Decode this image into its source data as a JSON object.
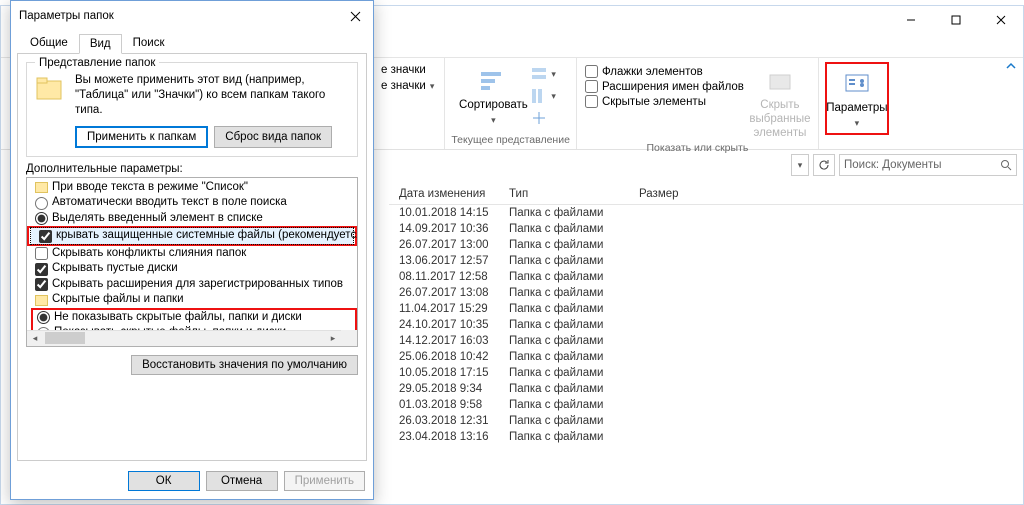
{
  "explorer": {
    "window_btns": {
      "help": "?"
    },
    "ribbon": {
      "groups": {
        "layout": {
          "small_icons": "е значки",
          "icons": "е значки",
          "group_label": ""
        },
        "view": {
          "sort": "Сортировать",
          "group_label": "Текущее представление"
        },
        "showhide": {
          "chk_flags": "Флажки элементов",
          "chk_ext": "Расширения имен файлов",
          "chk_hidden": "Скрытые элементы",
          "hide_selected": "Скрыть выбранные\nэлементы",
          "group_label": "Показать или скрыть"
        },
        "options": {
          "label": "Параметры"
        }
      }
    },
    "search": {
      "placeholder": "Поиск: Документы"
    },
    "grid": {
      "headers": {
        "date": "Дата изменения",
        "type": "Тип",
        "size": "Размер"
      },
      "rows": [
        {
          "date": "10.01.2018 14:15",
          "type": "Папка с файлами"
        },
        {
          "date": "14.09.2017 10:36",
          "type": "Папка с файлами"
        },
        {
          "date": "26.07.2017 13:00",
          "type": "Папка с файлами"
        },
        {
          "date": "13.06.2017 12:57",
          "type": "Папка с файлами"
        },
        {
          "date": "08.11.2017 12:58",
          "type": "Папка с файлами"
        },
        {
          "date": "26.07.2017 13:08",
          "type": "Папка с файлами"
        },
        {
          "date": "11.04.2017 15:29",
          "type": "Папка с файлами"
        },
        {
          "date": "24.10.2017 10:35",
          "type": "Папка с файлами"
        },
        {
          "date": "14.12.2017 16:03",
          "type": "Папка с файлами"
        },
        {
          "date": "25.06.2018 10:42",
          "type": "Папка с файлами"
        },
        {
          "date": "10.05.2018 17:15",
          "type": "Папка с файлами"
        },
        {
          "date": "29.05.2018 9:34",
          "type": "Папка с файлами"
        },
        {
          "date": "01.03.2018 9:58",
          "type": "Папка с файлами"
        },
        {
          "date": "26.03.2018 12:31",
          "type": "Папка с файлами"
        },
        {
          "date": "23.04.2018 13:16",
          "type": "Папка с файлами"
        }
      ]
    }
  },
  "dialog": {
    "title": "Параметры папок",
    "tabs": {
      "general": "Общие",
      "view": "Вид",
      "search": "Поиск"
    },
    "folderviews": {
      "legend": "Представление папок",
      "desc": "Вы можете применить этот вид (например, \"Таблица\" или \"Значки\") ко всем папкам такого типа.",
      "apply": "Применить к папкам",
      "reset": "Сброс вида папок"
    },
    "additional": "Дополнительные параметры:",
    "tree": {
      "list_mode": "При вводе текста в режиме \"Список\"",
      "auto_type": "Автоматически вводить текст в поле поиска",
      "select_typed": "Выделять введенный элемент в списке",
      "hide_protected": "крывать защищенные системные файлы (рекомендуется)",
      "hide_merge": "Скрывать конфликты слияния папок",
      "hide_empty": "Скрывать пустые диски",
      "hide_ext": "Скрывать расширения для зарегистрированных типов",
      "hidden_folder": "Скрытые файлы и папки",
      "not_show": "Не показывать скрытые файлы, папки и диски",
      "show": "Показывать скрытые файлы, папки и диски"
    },
    "restore": "Восстановить значения по умолчанию",
    "ok": "ОК",
    "cancel": "Отмена",
    "apply": "Применить"
  }
}
